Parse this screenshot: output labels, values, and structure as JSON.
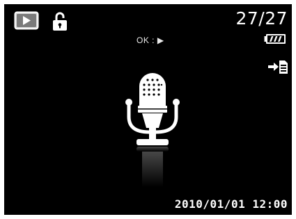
{
  "status": {
    "mode_icon": "playback-icon",
    "protect_icon": "lock-icon",
    "counter": "27/27",
    "ok_hint": "OK : ▶",
    "battery_icon": "battery-full-icon",
    "transfer_icon": "card-transfer-icon"
  },
  "main": {
    "media_icon": "microphone-icon"
  },
  "footer": {
    "datetime": "2010/01/01  12:00"
  }
}
